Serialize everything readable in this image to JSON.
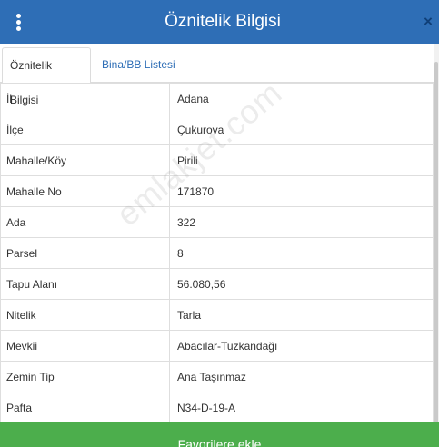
{
  "header": {
    "title": "Öznitelik Bilgisi",
    "close_label": "×"
  },
  "tabs": [
    {
      "label": "Öznitelik Bilgisi",
      "active": true
    },
    {
      "label": "Bina/BB Listesi",
      "active": false
    }
  ],
  "attributes": [
    {
      "key": "İl",
      "value": "Adana"
    },
    {
      "key": "İlçe",
      "value": "Çukurova"
    },
    {
      "key": "Mahalle/Köy",
      "value": "Pirili"
    },
    {
      "key": "Mahalle No",
      "value": "171870"
    },
    {
      "key": "Ada",
      "value": "322"
    },
    {
      "key": "Parsel",
      "value": "8"
    },
    {
      "key": "Tapu Alanı",
      "value": "56.080,56"
    },
    {
      "key": "Nitelik",
      "value": "Tarla"
    },
    {
      "key": "Mevkii",
      "value": "Abacılar-Tuzkandağı"
    },
    {
      "key": "Zemin Tip",
      "value": "Ana Taşınmaz"
    },
    {
      "key": "Pafta",
      "value": "N34-D-19-A"
    }
  ],
  "watermark": "emlakjet.com",
  "footer": {
    "favorites_label": "Favorilere ekle"
  },
  "colors": {
    "header": "#2e6eb6",
    "button": "#4cae4c",
    "tab_link": "#2e6eb6"
  },
  "icons": {
    "menu": "kebab-menu-icon",
    "close": "close-icon"
  }
}
